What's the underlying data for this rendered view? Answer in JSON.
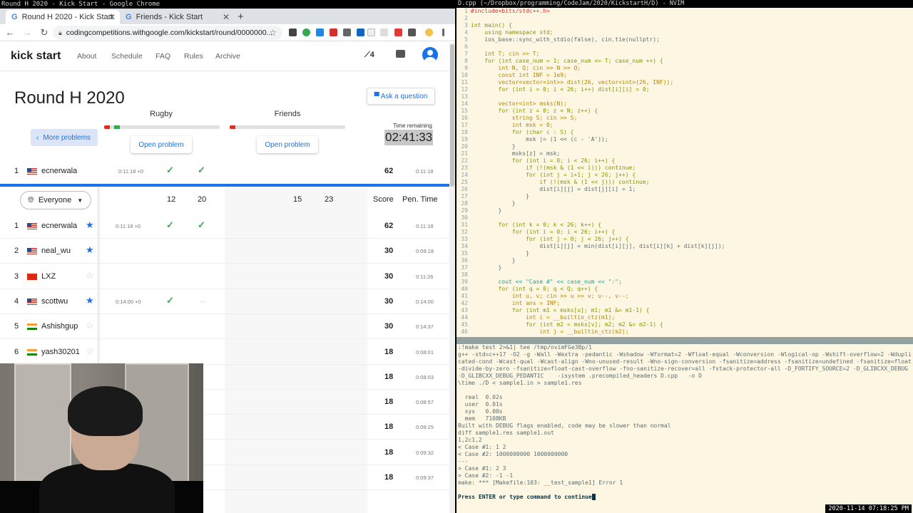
{
  "os": {
    "chrome_title": "Round H 2020 - Kick Start - Google Chrome",
    "terminal_title": "D.cpp (~/Dropbox/programming/CodeJam/2020/KickstartH/D) - NVIM",
    "clock": "2020-11-14 07:18:25 PM"
  },
  "browser": {
    "tabs": [
      {
        "label": "Round H 2020 - Kick Start"
      },
      {
        "label": "Friends - Kick Start"
      }
    ],
    "new_tab": "+",
    "url": "codingcompetitions.withgoogle.com/kickstart/round/0000000..."
  },
  "site": {
    "logo": "kick start",
    "nav": [
      "About",
      "Schedule",
      "FAQ",
      "Rules",
      "Archive"
    ],
    "trend_count": "4",
    "round_title": "Round H 2020",
    "ask_button": "Ask a question",
    "more_problems": "More problems",
    "problems": [
      {
        "name": "Rugby",
        "open": "Open problem"
      },
      {
        "name": "Friends",
        "open": "Open problem"
      }
    ],
    "time_label": "Time remaining",
    "time_value": "02:41:33"
  },
  "scoreboard": {
    "filter": "Everyone",
    "columns": [
      "12",
      "20",
      "15",
      "23",
      "Score",
      "Pen. Time"
    ],
    "pinned": {
      "rank": "1",
      "name": "ecnerwala",
      "time": "0:11:18 +0",
      "score": "62",
      "pen": "0:11:18"
    },
    "rows": [
      {
        "rank": "1",
        "flag": "us",
        "name": "ecnerwala",
        "fav": true,
        "time": "0:11:18 +0",
        "c1": true,
        "c2": true,
        "score": "62",
        "pen": "0:11:18"
      },
      {
        "rank": "2",
        "flag": "us",
        "name": "neal_wu",
        "fav": true,
        "time": "",
        "c1": false,
        "c2": false,
        "score": "30",
        "pen": "0:09:18"
      },
      {
        "rank": "3",
        "flag": "cn",
        "name": "LXZ",
        "fav": false,
        "time": "",
        "c1": false,
        "c2": false,
        "score": "30",
        "pen": "0:11:26"
      },
      {
        "rank": "4",
        "flag": "us",
        "name": "scottwu",
        "fav": true,
        "time": "0:14:00 +0",
        "c1": true,
        "c2": false,
        "score": "30",
        "pen": "0:14:00"
      },
      {
        "rank": "5",
        "flag": "in",
        "name": "Ashishgup",
        "fav": false,
        "time": "",
        "c1": false,
        "c2": false,
        "score": "30",
        "pen": "0:14:37"
      },
      {
        "rank": "6",
        "flag": "in",
        "name": "yash30201",
        "fav": false,
        "time": "",
        "c1": false,
        "c2": false,
        "score": "18",
        "pen": "0:08:01"
      },
      {
        "rank": "",
        "flag": "",
        "name": "",
        "fav": false,
        "time": "",
        "c1": false,
        "c2": false,
        "score": "18",
        "pen": "0:08:03"
      },
      {
        "rank": "",
        "flag": "",
        "name": "",
        "fav": false,
        "time": "",
        "c1": false,
        "c2": false,
        "score": "18",
        "pen": "0:08:57"
      },
      {
        "rank": "",
        "flag": "",
        "name": "",
        "fav": false,
        "time": "",
        "c1": false,
        "c2": false,
        "score": "18",
        "pen": "0:09:25"
      },
      {
        "rank": "",
        "flag": "",
        "name": "",
        "fav": false,
        "time": "",
        "c1": false,
        "c2": false,
        "score": "18",
        "pen": "0:09:32"
      },
      {
        "rank": "",
        "flag": "",
        "name": "",
        "fav": false,
        "time": "",
        "c1": false,
        "c2": false,
        "score": "18",
        "pen": "0:09:37"
      }
    ]
  },
  "editor": {
    "lines": [
      {
        "n": "1",
        "t": "#include<bits/stdc++.h>",
        "k": "pre"
      },
      {
        "n": "2",
        "t": "",
        "k": ""
      },
      {
        "n": "3",
        "t": "int main() {",
        "k": "kw"
      },
      {
        "n": "4",
        "t": "    using namespace std;",
        "k": "kw"
      },
      {
        "n": "5",
        "t": "    ios_base::sync_with_stdio(false), cin.tie(nullptr);",
        "k": ""
      },
      {
        "n": "6",
        "t": "",
        "k": ""
      },
      {
        "n": "7",
        "t": "    int T; cin >> T;",
        "k": "ty"
      },
      {
        "n": "8",
        "t": "    for (int case_num = 1; case_num <= T; case_num ++) {",
        "k": "kw"
      },
      {
        "n": "9",
        "t": "        int N, Q; cin >> N >> Q;",
        "k": "ty"
      },
      {
        "n": "10",
        "t": "        const int INF = 1e9;",
        "k": "ty"
      },
      {
        "n": "11",
        "t": "        vector<vector<int>> dist(26, vector<int>(26, INF));",
        "k": "ty"
      },
      {
        "n": "12",
        "t": "        for (int i = 0; i < 26; i++) dist[i][i] = 0;",
        "k": "kw"
      },
      {
        "n": "13",
        "t": "",
        "k": ""
      },
      {
        "n": "14",
        "t": "        vector<int> msks(N);",
        "k": "ty"
      },
      {
        "n": "15",
        "t": "        for (int z = 0; z < N; z++) {",
        "k": "kw"
      },
      {
        "n": "16",
        "t": "            string S; cin >> S;",
        "k": "ty"
      },
      {
        "n": "17",
        "t": "            int msk = 0;",
        "k": "ty"
      },
      {
        "n": "18",
        "t": "            for (char c : S) {",
        "k": "kw"
      },
      {
        "n": "19",
        "t": "                msk |= (1 << (c - 'A'));",
        "k": ""
      },
      {
        "n": "20",
        "t": "            }",
        "k": ""
      },
      {
        "n": "21",
        "t": "            msks[z] = msk;",
        "k": ""
      },
      {
        "n": "22",
        "t": "            for (int i = 0; i < 26; i++) {",
        "k": "kw"
      },
      {
        "n": "23",
        "t": "                if (!(msk & (1 << i))) continue;",
        "k": "kw"
      },
      {
        "n": "24",
        "t": "                for (int j = i+1; j < 26; j++) {",
        "k": "kw"
      },
      {
        "n": "25",
        "t": "                    if (!(msk & (1 << j))) continue;",
        "k": "kw"
      },
      {
        "n": "26",
        "t": "                    dist[i][j] = dist[j][i] = 1;",
        "k": ""
      },
      {
        "n": "27",
        "t": "                }",
        "k": ""
      },
      {
        "n": "28",
        "t": "            }",
        "k": ""
      },
      {
        "n": "29",
        "t": "        }",
        "k": ""
      },
      {
        "n": "30",
        "t": "",
        "k": ""
      },
      {
        "n": "31",
        "t": "        for (int k = 0; k < 26; k++) {",
        "k": "kw"
      },
      {
        "n": "32",
        "t": "            for (int i = 0; i < 26; i++) {",
        "k": "kw"
      },
      {
        "n": "33",
        "t": "                for (int j = 0; j < 26; j++) {",
        "k": "kw"
      },
      {
        "n": "34",
        "t": "                    dist[i][j] = min(dist[i][j], dist[i][k] + dist[k][j]);",
        "k": ""
      },
      {
        "n": "35",
        "t": "                }",
        "k": ""
      },
      {
        "n": "36",
        "t": "            }",
        "k": ""
      },
      {
        "n": "37",
        "t": "        }",
        "k": ""
      },
      {
        "n": "38",
        "t": "",
        "k": ""
      },
      {
        "n": "39",
        "t": "        cout << \"Case #\" << case_num << \":\";",
        "k": "str"
      },
      {
        "n": "40",
        "t": "        for (int q = 0; q < Q; q++) {",
        "k": "kw"
      },
      {
        "n": "41",
        "t": "            int u, v; cin >> u >> v; u--, v--;",
        "k": "ty"
      },
      {
        "n": "42",
        "t": "            int ans = INF;",
        "k": "ty"
      },
      {
        "n": "43",
        "t": "            for (int m1 = msks[u]; m1; m1 &= m1-1) {",
        "k": "kw"
      },
      {
        "n": "44",
        "t": "                int i = __builtin_ctz(m1);",
        "k": "ty"
      },
      {
        "n": "45",
        "t": "                for (int m2 = msks[v]; m2; m2 &= m2-1) {",
        "k": "kw"
      },
      {
        "n": "46",
        "t": "                    int j = __builtin_ctz(m2);",
        "k": "ty"
      }
    ],
    "output": [
      {
        "t": ":!make test 2>&1| tee /tmp/nvimFGe3Bp/1",
        "b": false
      },
      {
        "t": "g++ -std=c++17 -O2 -g -Wall -Wextra -pedantic -Wshadow -Wformat=2 -Wfloat-equal -Wconversion -Wlogical-op -Wshift-overflow=2 -Wduplicated-cond -Wcast-qual -Wcast-align -Wno-unused-result -Wno-sign-conversion -fsanitize=address -fsanitize=undefined -fsanitize=float-divide-by-zero -fsanitize=float-cast-overflow -fno-sanitize-recover=all -fstack-protector-all -D_FORTIFY_SOURCE=2 -D_GLIBCXX_DEBUG -D_GLIBCXX_DEBUG_PEDANTIC    -isystem .precompiled_headers D.cpp   -o D",
        "b": false
      },
      {
        "t": "\\time ./D < sample1.in > sample1.res",
        "b": false
      },
      {
        "t": " ",
        "b": false
      },
      {
        "t": "  real  0.02s",
        "b": false
      },
      {
        "t": "  user  0.01s",
        "b": false
      },
      {
        "t": "  sys   0.00s",
        "b": false
      },
      {
        "t": "  mem   7108KB",
        "b": false
      },
      {
        "t": "Built with DEBUG flags enabled, code may be slower than normal",
        "b": false
      },
      {
        "t": "diff sample1.res sample1.out",
        "b": false
      },
      {
        "t": "1,2c1,2",
        "b": false
      },
      {
        "t": "< Case #1: 1 2",
        "b": false
      },
      {
        "t": "< Case #2: 1000000000 1000000000",
        "b": false
      },
      {
        "t": "---",
        "b": false
      },
      {
        "t": "> Case #1: 2 3",
        "b": false
      },
      {
        "t": "> Case #2: -1 -1",
        "b": false
      },
      {
        "t": "make: *** [Makefile:103: __test_sample1] Error 1",
        "b": false
      },
      {
        "t": " ",
        "b": false
      },
      {
        "t": "Press ENTER or type command to continue",
        "b": true
      }
    ]
  }
}
